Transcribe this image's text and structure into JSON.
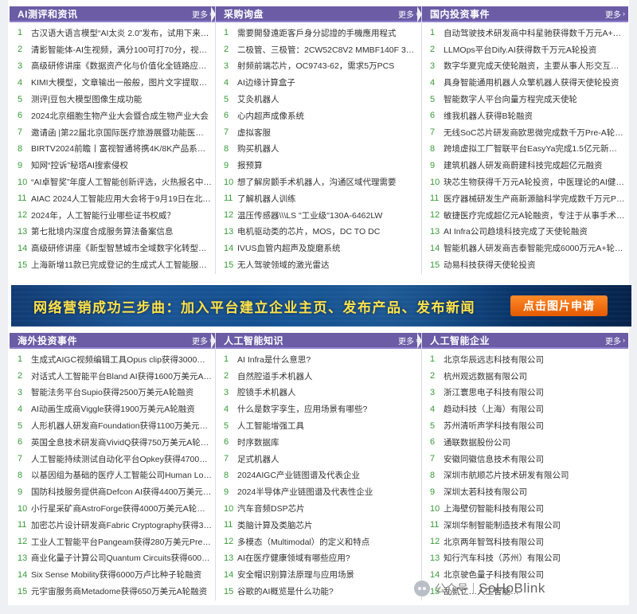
{
  "top_section": [
    {
      "title": "AI测评和资讯",
      "more": "更多",
      "items": [
        {
          "n": "1",
          "t": "古汉语大语言模型“AI太炎 2.0”发布，试用下来…"
        },
        {
          "n": "2",
          "t": "清影智能体-AI生视频，满分100可打70分，视频…"
        },
        {
          "n": "3",
          "t": "高级研修讲座《数据资产化与价值化全链路应用解…"
        },
        {
          "n": "4",
          "t": "KIMI大模型，文章输出一般般，图片文字提取好用"
        },
        {
          "n": "5",
          "t": "测评|豆包大模型图像生成功能"
        },
        {
          "n": "6",
          "t": "2024北京细胞生物产业大会暨合成生物产业大会"
        },
        {
          "n": "7",
          "t": "邀请函 |第22届北京国际医疗旅游展暨功能医学创…"
        },
        {
          "n": "8",
          "t": "BIRTV2024前瞻丨富视智通将携4K/8K产品系列…"
        },
        {
          "n": "9",
          "t": "知网“控诉”秘塔AI搜索侵权"
        },
        {
          "n": "10",
          "t": "“AI卓智奖”年度人工智能创新评选，火热报名中…"
        },
        {
          "n": "11",
          "t": "AIAC 2024人工智能应用大会将于9月19日在北…"
        },
        {
          "n": "12",
          "t": "2024年，人工智能行业哪些证书权威？"
        },
        {
          "n": "13",
          "t": "第七批境内深度合成服务算法备案信息"
        },
        {
          "n": "14",
          "t": "高级研修讲座《新型智慧城市全域数字化转型技术…"
        },
        {
          "n": "15",
          "t": "上海新增11款已完成登记的生成式人工智能服务…"
        }
      ]
    },
    {
      "title": "采购询盘",
      "more": "更多",
      "items": [
        {
          "n": "1",
          "t": "需要開發遠距客戶身分認證的手機應用程式"
        },
        {
          "n": "2",
          "t": "二极管、三极管：2CW52C8V2 MMBF140F 3DG…"
        },
        {
          "n": "3",
          "t": "射频前端芯片，OC9743-62，需求5万PCS"
        },
        {
          "n": "4",
          "t": "AI边缘计算盒子"
        },
        {
          "n": "5",
          "t": "艾灸机器人"
        },
        {
          "n": "6",
          "t": "心内超声成像系统"
        },
        {
          "n": "7",
          "t": "虚拟客服"
        },
        {
          "n": "8",
          "t": "购买机器人"
        },
        {
          "n": "9",
          "t": "报预算"
        },
        {
          "n": "10",
          "t": "想了解房颤手术机器人，沟通区域代理需要"
        },
        {
          "n": "11",
          "t": "了解机器人训练"
        },
        {
          "n": "12",
          "t": "温压传感器\\\\\\LS \"工业级\"130A-6462LW"
        },
        {
          "n": "13",
          "t": "电机驱动类的芯片，MOS，DC TO DC"
        },
        {
          "n": "14",
          "t": "IVUS血管内超声及旋磨系统"
        },
        {
          "n": "15",
          "t": "无人驾驶领域的激光雷达"
        }
      ]
    },
    {
      "title": "国内投资事件",
      "more": "更多",
      "items": [
        {
          "n": "1",
          "t": "自动驾驶技术研发商中科星驰获得数千万元A+轮…"
        },
        {
          "n": "2",
          "t": "LLMOps平台Dify.AI获得数千万元A轮投资"
        },
        {
          "n": "3",
          "t": "数字华夏完成天使轮融资，主要从事人形交互机器…"
        },
        {
          "n": "4",
          "t": "具身智能通用机器人众擎机器人获得天使轮投资"
        },
        {
          "n": "5",
          "t": "智能数字人平台向量方程完成天使轮"
        },
        {
          "n": "6",
          "t": "维我机器人获得B轮融资"
        },
        {
          "n": "7",
          "t": "无线SoC芯片研发商欧思微完成数千万Pre-A轮融资"
        },
        {
          "n": "8",
          "t": "跨境虚拟工厂智联平台EasyYa完成1.5亿元新一轮…"
        },
        {
          "n": "9",
          "t": "建筑机器人研发商蔚建科技完成超亿元融资"
        },
        {
          "n": "10",
          "t": "玦芯生物获得千万元A轮投资，中医理论的AI健康…"
        },
        {
          "n": "11",
          "t": "医疗器械研发生产商新源脑科学完成数千万元Pre…"
        },
        {
          "n": "12",
          "t": "敏捷医疗完成超亿元A轮融资，专注于从事手术机…"
        },
        {
          "n": "13",
          "t": "AI Infra公司趋境科技完成了天使轮融资"
        },
        {
          "n": "14",
          "t": "智能机器人研发商吉泰智能完成6000万元A+轮融资"
        },
        {
          "n": "15",
          "t": "动易科技获得天使轮投资"
        }
      ]
    }
  ],
  "banner": {
    "text": "网络营销成功三步曲：加入平台建立企业主页、发布产品、发布新闻",
    "button": "点击图片申请"
  },
  "bottom_section": [
    {
      "title": "海外投资事件",
      "more": "更多",
      "items": [
        {
          "n": "1",
          "t": "生成式AIGC视频编辑工具Opus clip获得3000万…"
        },
        {
          "n": "2",
          "t": "对话式人工智能平台Bland AI获得1600万美元A…"
        },
        {
          "n": "3",
          "t": "智能法务平台Supio获得2500万美元A轮融资"
        },
        {
          "n": "4",
          "t": "AI动画生成商Viggle获得1900万美元A轮融资"
        },
        {
          "n": "5",
          "t": "人形机器人研发商Foundation获得1100万美元…"
        },
        {
          "n": "6",
          "t": "英国全息技术研发商VividQ获得750万美元A轮融资"
        },
        {
          "n": "7",
          "t": "人工智能持续测试自动化平台Opkey获得4700万…"
        },
        {
          "n": "8",
          "t": "以基因组为基础的医疗人工智能公司Human Lon…"
        },
        {
          "n": "9",
          "t": "国防科技服务提供商Defcon AI获得4400万美元…"
        },
        {
          "n": "10",
          "t": "小行星采矿商AstroForge获得4000万美元A轮融资"
        },
        {
          "n": "11",
          "t": "加密芯片设计研发商Fabric Cryptography获得3…"
        },
        {
          "n": "12",
          "t": "工业人工智能平台Pangeam获得280万美元Pre-…"
        },
        {
          "n": "13",
          "t": "商业化量子计算公司Quantum Circuits获得600…"
        },
        {
          "n": "14",
          "t": "Six Sense Mobility获得6000万卢比种子轮融资"
        },
        {
          "n": "15",
          "t": "元宇宙服务商Metadome获得650万美元A轮融资"
        }
      ]
    },
    {
      "title": "人工智能知识",
      "more": "更多",
      "items": [
        {
          "n": "1",
          "t": "AI Infra是什么意思?"
        },
        {
          "n": "2",
          "t": "自然腔道手术机器人"
        },
        {
          "n": "3",
          "t": "腔镜手术机器人"
        },
        {
          "n": "4",
          "t": "什么是数字孪生，应用场景有哪些?"
        },
        {
          "n": "5",
          "t": "人工智能增强工具"
        },
        {
          "n": "6",
          "t": "时序数据库"
        },
        {
          "n": "7",
          "t": "足式机器人"
        },
        {
          "n": "8",
          "t": "2024AIGC产业链图谱及代表企业"
        },
        {
          "n": "9",
          "t": "2024半导体产业链图谱及代表性企业"
        },
        {
          "n": "10",
          "t": "汽车音频DSP芯片"
        },
        {
          "n": "11",
          "t": "类脑计算及类脑芯片"
        },
        {
          "n": "12",
          "t": "多模态（Multimodal）的定义和特点"
        },
        {
          "n": "13",
          "t": "AI在医疗健康领域有哪些应用?"
        },
        {
          "n": "14",
          "t": "安全帽识别算法原理与应用场景"
        },
        {
          "n": "15",
          "t": "谷歌的AI概览是什么功能?"
        }
      ]
    },
    {
      "title": "人工智能企业",
      "more": "更多",
      "items": [
        {
          "n": "1",
          "t": "北京华辰远志科技有限公司"
        },
        {
          "n": "2",
          "t": "杭州观远数据有限公司"
        },
        {
          "n": "3",
          "t": "浙江寰思电子科技有限公司"
        },
        {
          "n": "4",
          "t": "趋动科技（上海）有限公司"
        },
        {
          "n": "5",
          "t": "苏州清听声学科技有限公司"
        },
        {
          "n": "6",
          "t": "通联数据股份公司"
        },
        {
          "n": "7",
          "t": "安徽同徽信息技术有限公司"
        },
        {
          "n": "8",
          "t": "深圳市航顺芯片技术研发有限公司"
        },
        {
          "n": "9",
          "t": "深圳太若科技有限公司"
        },
        {
          "n": "10",
          "t": "上海壁仞智能科技有限公司"
        },
        {
          "n": "11",
          "t": "深圳华制智能制造技术有限公司"
        },
        {
          "n": "12",
          "t": "北京两年智驾科技有限公司"
        },
        {
          "n": "13",
          "t": "知行汽车科技（苏州）有限公司"
        },
        {
          "n": "14",
          "t": "北京驶色量子科技有限公司"
        },
        {
          "n": "15",
          "t": "乱贰仁…人工智能…"
        }
      ]
    }
  ],
  "watermark": {
    "label": "公众号",
    "brand": "SoHoBlink"
  }
}
